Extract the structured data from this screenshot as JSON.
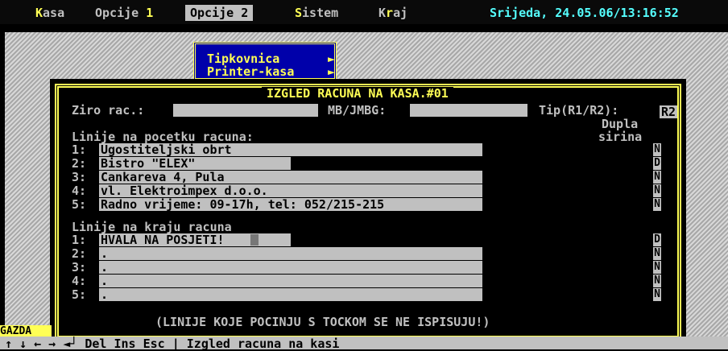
{
  "menu": {
    "items": [
      {
        "hotkey": "K",
        "rest": "asa"
      },
      {
        "hotkey": "",
        "rest": "Opcije ",
        "suffix": "1"
      },
      {
        "hotkey": "",
        "rest": "Opcije 2"
      },
      {
        "hotkey": "S",
        "rest": "istem"
      },
      {
        "hotkey": "",
        "pre": "K",
        "hotmid": "r",
        "rest": "aj"
      }
    ],
    "clock": "Srijeda, 24.05.06/13:16:52"
  },
  "submenu": {
    "items": [
      {
        "label": "Tipkovnica",
        "arrow": "►"
      },
      {
        "label": "Printer-kasa",
        "arrow": "►"
      }
    ]
  },
  "dialog": {
    "title": "IZGLED RACUNA NA KASA.#01",
    "ziro_label": "Ziro rac.:",
    "ziro_value": "",
    "mb_label": "MB/JMBG:",
    "mb_value": "",
    "tip_label": "Tip(R1/R2):",
    "tip_value": "R2",
    "dupla_label_1": "Dupla",
    "dupla_label_2": "sirina",
    "header_section": "Linije na pocetku racuna:",
    "header_lines": [
      {
        "num": "1:",
        "text": "Ugostiteljski obrt",
        "flag": "N"
      },
      {
        "num": "2:",
        "text": "Bistro \"ELEX\"",
        "flag": "D"
      },
      {
        "num": "3:",
        "text": "Cankareva 4, Pula",
        "flag": "N"
      },
      {
        "num": "4:",
        "text": "vl. Elektroimpex d.o.o.",
        "flag": "N"
      },
      {
        "num": "5:",
        "text": "Radno vrijeme: 09-17h, tel: 052/215-215",
        "flag": "N"
      }
    ],
    "footer_section": "Linije na kraju racuna",
    "footer_lines": [
      {
        "num": "1:",
        "text": "HVALA NA POSJETI!",
        "flag": "D"
      },
      {
        "num": "2:",
        "text": ".",
        "flag": "N"
      },
      {
        "num": "3:",
        "text": ".",
        "flag": "N"
      },
      {
        "num": "4:",
        "text": ".",
        "flag": "N"
      },
      {
        "num": "5:",
        "text": ".",
        "flag": "N"
      }
    ],
    "note": "(LINIJE KOJE POCINJU S TOCKOM SE NE ISPISUJU!)"
  },
  "status": {
    "user": "GAZDA",
    "keys": "↑ ↓ ← → ◄┘ Del Ins Esc | Izgled racuna na kasi"
  },
  "colors": {
    "yellow": "#ffff55",
    "cyan": "#55ffff",
    "gray": "#c0c0c0",
    "blue": "#0000aa"
  }
}
